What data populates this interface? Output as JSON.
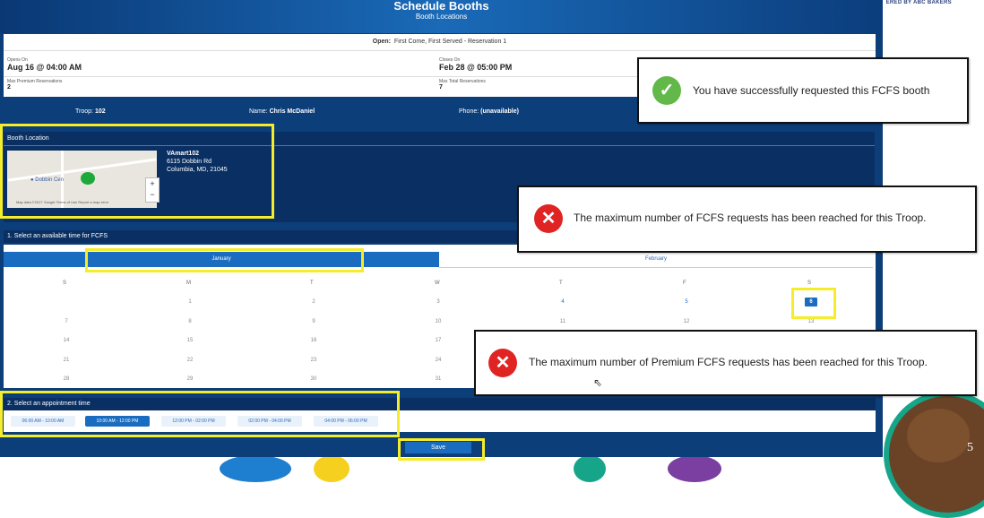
{
  "slide": {
    "corner_text": "ERED BY ABC BAKERS",
    "page_number": "5"
  },
  "header": {
    "title": "Schedule Booths",
    "subtitle": "Booth Locations"
  },
  "info": {
    "open_label": "Open:",
    "open_value": "First Come, First Served - Reservation 1",
    "opens_on_label": "Opens On",
    "opens_on_value": "Aug 16 @ 04:00 AM",
    "closes_on_label": "Closes On",
    "closes_on_value": "Feb 28 @ 05:00 PM",
    "max_premium_label": "Max Premium Reservations",
    "max_premium_value": "2",
    "max_total_label": "Max Total Reservations",
    "max_total_value": "7"
  },
  "troop_bar": {
    "troop_label": "Troop:",
    "troop_value": "102",
    "name_label": "Name:",
    "name_value": "Chris McDaniel",
    "phone_label": "Phone:",
    "phone_value": "(unavailable)"
  },
  "booth": {
    "section_title": "Booth Location",
    "map_label": "Dobbin Cen",
    "map_footer": "Map data ©2017 Google   Terms of Use   Report a map error",
    "name": "VAmart102",
    "street": "6115 Dobbin Rd",
    "city": "Columbia, MD, 21045"
  },
  "calendar": {
    "section_title": "1. Select an available time for FCFS",
    "months": [
      "January",
      "February"
    ],
    "day_headers": [
      "S",
      "M",
      "T",
      "W",
      "T",
      "F",
      "S"
    ],
    "weeks": [
      [
        "",
        "1",
        "2",
        "3",
        "4",
        "5",
        "6"
      ],
      [
        "7",
        "8",
        "9",
        "10",
        "11",
        "12",
        "13"
      ],
      [
        "14",
        "15",
        "16",
        "17",
        "",
        "",
        ""
      ],
      [
        "21",
        "22",
        "23",
        "24",
        "",
        "",
        ""
      ],
      [
        "28",
        "29",
        "30",
        "31",
        "",
        "",
        ""
      ]
    ],
    "selected_day": "6"
  },
  "appointment": {
    "section_title": "2. Select an appointment time",
    "slots": [
      "06:00 AM - 10:00 AM",
      "10:00 AM - 12:00 PM",
      "12:00 PM - 02:00 PM",
      "02:00 PM - 04:00 PM",
      "04:00 PM - 06:00 PM"
    ],
    "selected_slot": "10:00 AM - 12:00 PM"
  },
  "save_label": "Save",
  "popups": {
    "success": "You have successfully requested this FCFS booth",
    "error_fcfs": "The maximum number of FCFS requests has been reached for this Troop.",
    "error_premium": "The maximum number of Premium FCFS requests has been reached for this Troop."
  },
  "colors": {
    "primary": "#0c3e7a",
    "accent": "#1a6cc0",
    "highlight": "#f5ec2a",
    "success": "#63b84a",
    "error": "#e02424"
  }
}
